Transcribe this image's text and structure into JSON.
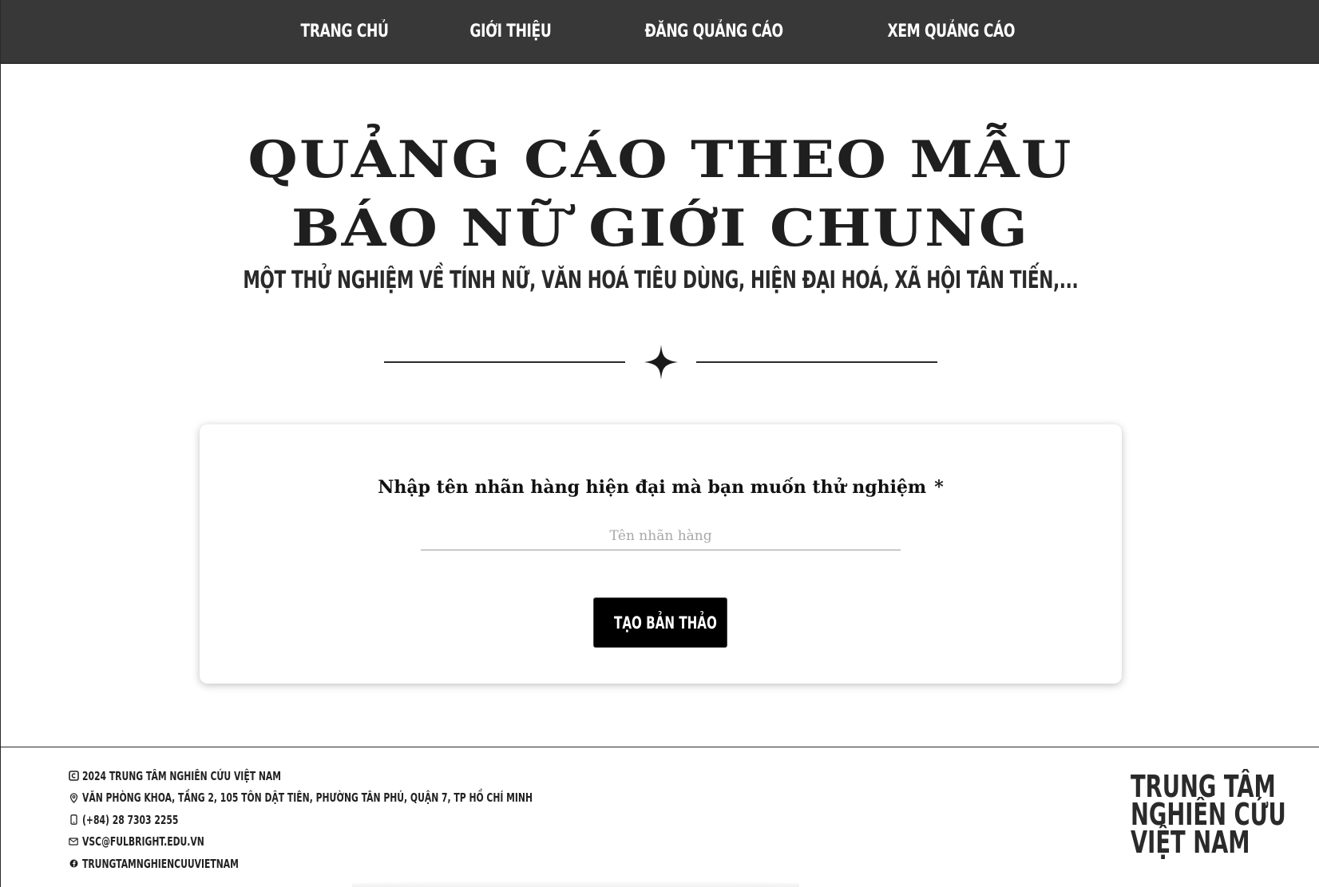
{
  "nav": {
    "items": [
      {
        "label": "TRANG CHỦ"
      },
      {
        "label": "GIỚI THIỆU"
      },
      {
        "label": "ĐĂNG QUẢNG CÁO"
      },
      {
        "label": "XEM QUẢNG CÁO"
      }
    ]
  },
  "hero": {
    "title_line1": "QUẢNG CÁO THEO MẪU",
    "title_line2": "BÁO NỮ GIỚI CHUNG",
    "subtitle": "MỘT THỬ NGHIỆM VỀ TÍNH NỮ, VĂN HOÁ TIÊU DÙNG, HIỆN ĐẠI HOÁ, XÃ HỘI TÂN TIẾN,..."
  },
  "form": {
    "label": "Nhập tên nhãn hàng hiện đại mà bạn muốn thử nghiệm",
    "required_mark": "*",
    "input_value": "",
    "input_placeholder": "Tên nhãn hàng",
    "submit_label": "TẠO BẢN THẢO"
  },
  "footer": {
    "copyright": "2024 TRUNG TÂM NGHIÊN CỨU VIỆT NAM",
    "address": "VĂN PHÒNG KHOA, TẦNG 2, 105 TÔN DẬT TIÊN, PHƯỜNG TÂN PHÚ, QUẬN 7, TP HỒ CHÍ MINH",
    "phone": "(+84) 28 7303 2255",
    "email": "VSC@FULBRIGHT.EDU.VN",
    "facebook": "TRUNGTAMNGHIENCUUVIETNAM",
    "logo_line1": "TRUNG TÂM",
    "logo_line2": "NGHIÊN CỨU",
    "logo_line3": "VIỆT NAM"
  },
  "icons": {
    "copyright": "copyright-icon",
    "location": "location-pin-icon",
    "phone": "phone-icon",
    "email": "mail-icon",
    "facebook": "facebook-icon",
    "divider": "four-point-star-icon"
  },
  "colors": {
    "nav_bg": "#383838",
    "button_bg": "#000000",
    "text": "#1c1c1c"
  }
}
